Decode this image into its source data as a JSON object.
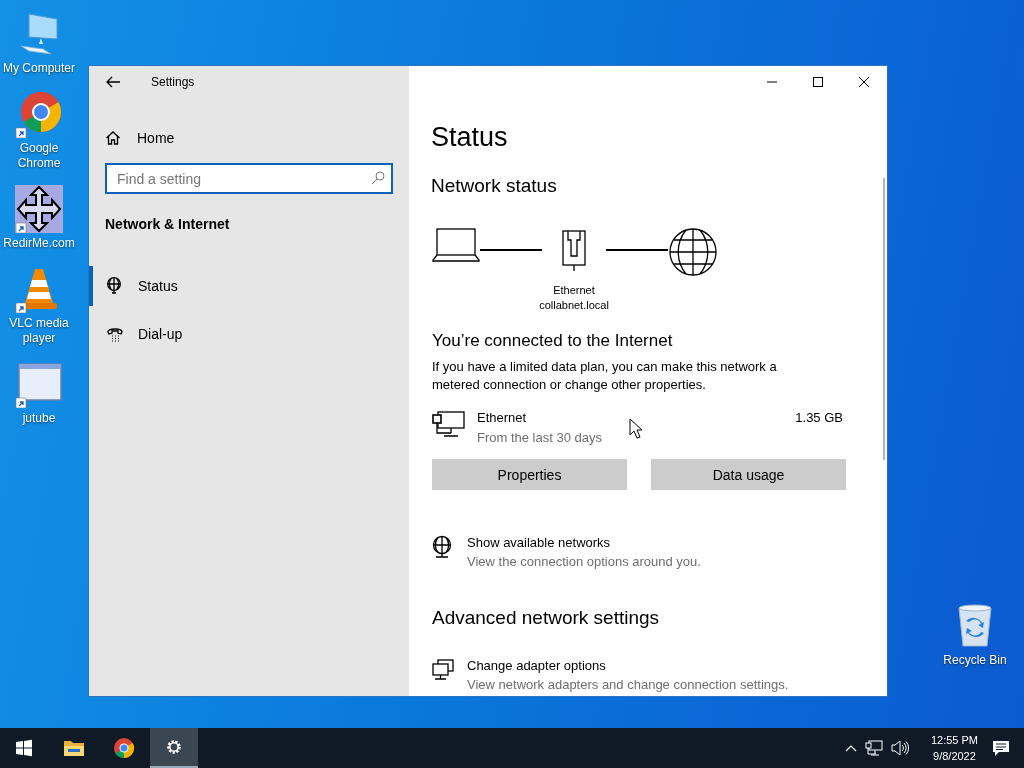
{
  "desktop_icons": [
    {
      "kind": "computer",
      "label": "My Computer"
    },
    {
      "kind": "chrome",
      "label": "Google Chrome"
    },
    {
      "kind": "redirme",
      "label": "RedirMe.com"
    },
    {
      "kind": "vlc",
      "label": "VLC media player"
    },
    {
      "kind": "app",
      "label": "jutube"
    },
    {
      "kind": "recycle",
      "label": "Recycle Bin"
    }
  ],
  "window": {
    "title": "Settings",
    "sidebar": {
      "home": "Home",
      "search": {
        "placeholder": "Find a setting"
      },
      "section": "Network & Internet",
      "items": [
        {
          "kind": "status",
          "label": "Status",
          "selected": true
        },
        {
          "kind": "dialup",
          "label": "Dial-up",
          "selected": false
        }
      ]
    },
    "content": {
      "title": "Status",
      "network_status": {
        "heading": "Network status",
        "adapter": "Ethernet",
        "domain": "collabnet.local"
      },
      "connection": {
        "heading": "You’re connected to the Internet",
        "description": "If you have a limited data plan, you can make this network a metered connection or change other properties.",
        "usage": {
          "name": "Ethernet",
          "period": "From the last 30 days",
          "amount": "1.35 GB"
        },
        "buttons": [
          "Properties",
          "Data usage"
        ]
      },
      "options": [
        {
          "kind": "globe",
          "title": "Show available networks",
          "subtitle": "View the connection options around you."
        }
      ],
      "advanced": {
        "heading": "Advanced network settings",
        "options": [
          {
            "kind": "adapter",
            "title": "Change adapter options",
            "subtitle": "View network adapters and change connection settings."
          }
        ]
      }
    }
  },
  "taskbar": {
    "apps": [
      {
        "kind": "start",
        "selected": false
      },
      {
        "kind": "explorer",
        "selected": false
      },
      {
        "kind": "chrome",
        "selected": false
      },
      {
        "kind": "settings",
        "selected": true
      }
    ],
    "time": "12:55 PM",
    "date": "9/8/2022"
  }
}
